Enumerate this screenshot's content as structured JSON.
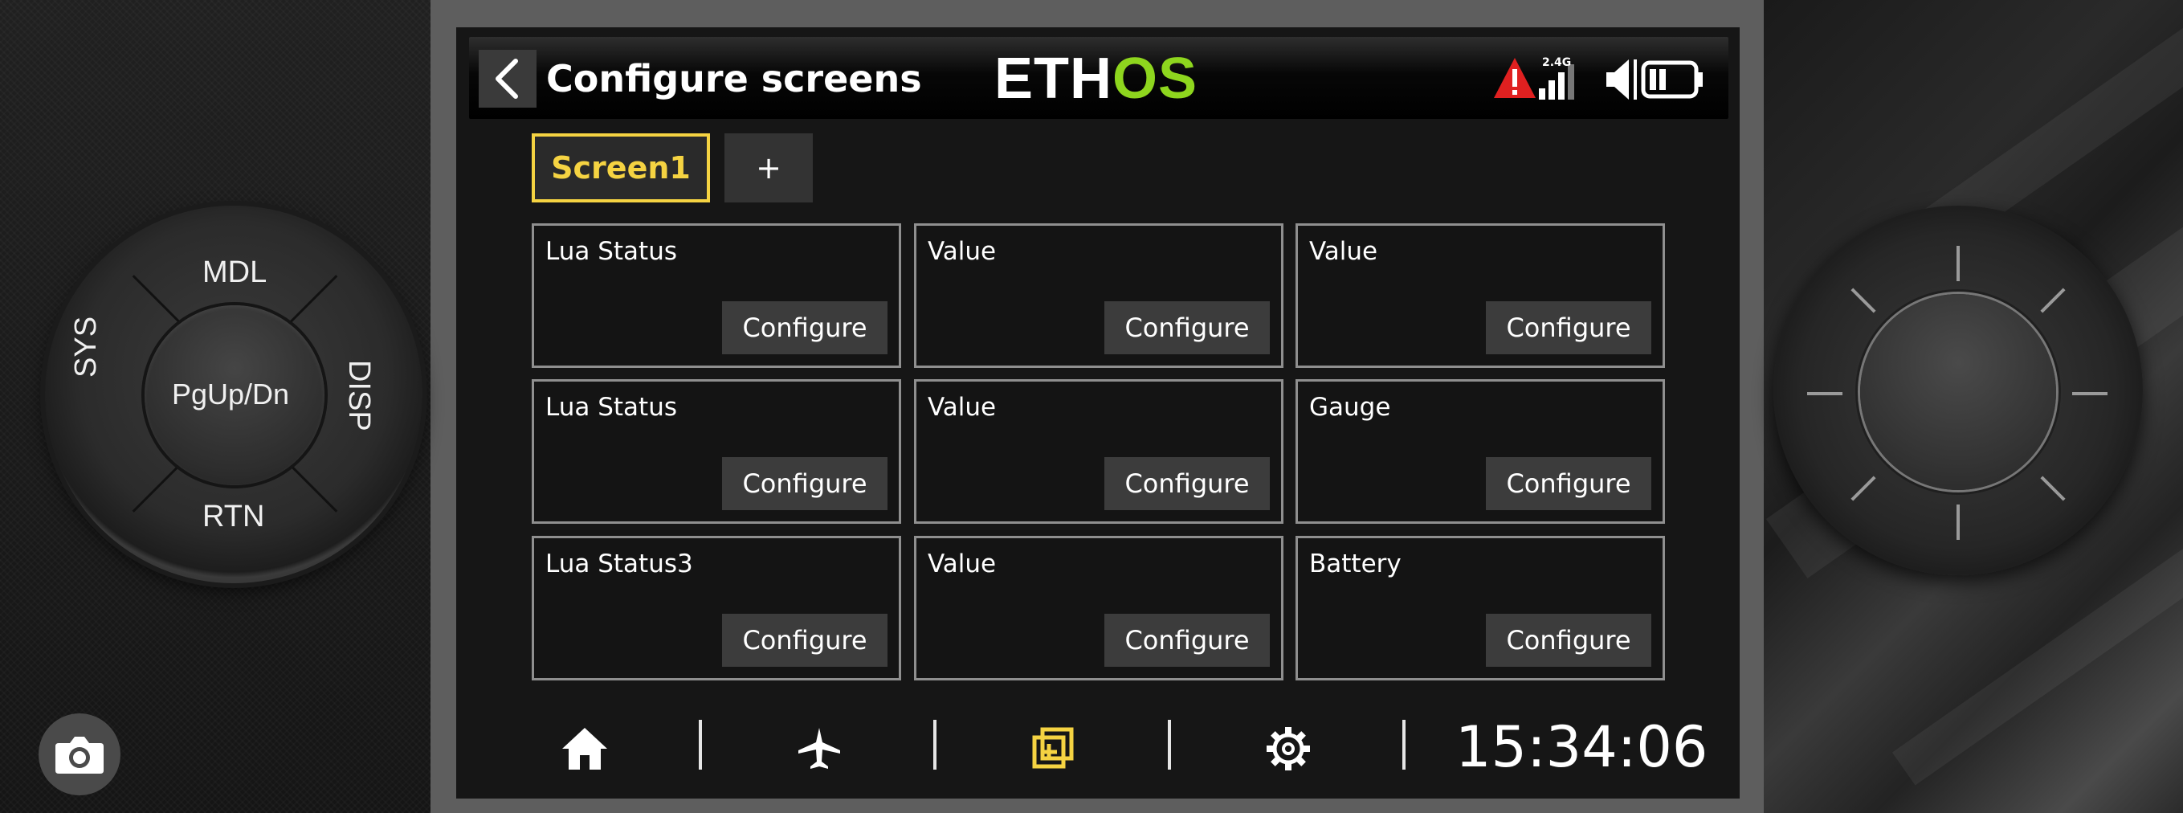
{
  "header": {
    "title": "Configure screens",
    "logo_main": "ETH",
    "logo_accent": "OS",
    "rf_band": "2.4G"
  },
  "tabs": [
    {
      "label": "Screen1",
      "selected": true
    },
    {
      "label": "+",
      "selected": false
    }
  ],
  "widgets": [
    {
      "label": "Lua Status",
      "button": "Configure"
    },
    {
      "label": "Value",
      "button": "Configure"
    },
    {
      "label": "Value",
      "button": "Configure"
    },
    {
      "label": "Lua Status",
      "button": "Configure"
    },
    {
      "label": "Value",
      "button": "Configure"
    },
    {
      "label": "Gauge",
      "button": "Configure"
    },
    {
      "label": "Lua Status3",
      "button": "Configure"
    },
    {
      "label": "Value",
      "button": "Configure"
    },
    {
      "label": "Battery",
      "button": "Configure"
    }
  ],
  "bottom_nav": {
    "items": [
      {
        "icon": "home-icon"
      },
      {
        "icon": "airplane-icon"
      },
      {
        "icon": "screens-icon",
        "active": true
      },
      {
        "icon": "gear-icon"
      }
    ],
    "clock": "15:34:06"
  },
  "left_dial": {
    "top": "MDL",
    "left": "SYS",
    "right": "DISP",
    "bottom": "RTN",
    "center": "PgUp/Dn"
  },
  "colors": {
    "accent_yellow": "#f5d342",
    "logo_green": "#8ed61e",
    "warning_red": "#e02020"
  }
}
